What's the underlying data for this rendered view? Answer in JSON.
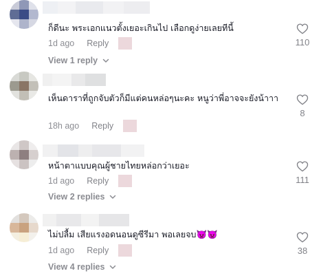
{
  "comments": [
    {
      "text": "ก็ดีนะ พระเอกแนวตั้งเยอะเกินไป เลือกดูง่ายเลยทีนี้",
      "time": "1d ago",
      "reply_label": "Reply",
      "likes": "110",
      "view_replies": "View 1 reply",
      "avatar_colors": [
        "#c9cbd8",
        "#8f98b7",
        "#dfe1ea",
        "#5f6d95",
        "#3b4c86",
        "#b2b8cf",
        "#e5e6ee",
        "#aeb4cb",
        "#d6d8e3"
      ]
    },
    {
      "text": "เห็นดาราที่ถูกจับตัวก็มีแต่คนหล่อๆนะคะ หนูว่าพี่อาจจะยังน้าาา",
      "time": "18h ago",
      "reply_label": "Reply",
      "likes": "8",
      "view_replies": "",
      "avatar_colors": [
        "#d9dad6",
        "#c8c9c2",
        "#e6e6e2",
        "#9c9a8f",
        "#8a7565",
        "#c3c0b8",
        "#e2e2de",
        "#c2bfb6",
        "#e9e9e6"
      ]
    },
    {
      "text": "หน้าตาแบบคุณผู้ชายไทยหล่อกว่าเยอะ",
      "time": "1d ago",
      "reply_label": "Reply",
      "likes": "111",
      "view_replies": "View 2 replies",
      "avatar_colors": [
        "#e9e6e6",
        "#cfc7c6",
        "#efeded",
        "#bcb1b0",
        "#8e7f80",
        "#d6cfce",
        "#e6e1e1",
        "#cbc3c2",
        "#ededed"
      ]
    },
    {
      "text": "ไม่ปลื้ม เสียแรงอดนอนดูซีรีมา พอเลยจบ👿👿",
      "time": "1d ago",
      "reply_label": "Reply",
      "likes": "38",
      "view_replies": "View 4 replies",
      "avatar_colors": [
        "#e2e0de",
        "#d4c8bd",
        "#ecebe9",
        "#d8b79a",
        "#c9a27f",
        "#e7d9cc",
        "#f4efe0",
        "#f6eed6",
        "#f3f1ec"
      ]
    }
  ],
  "icons": {
    "like": "heart-outline-icon",
    "chevron": "chevron-down-icon"
  }
}
